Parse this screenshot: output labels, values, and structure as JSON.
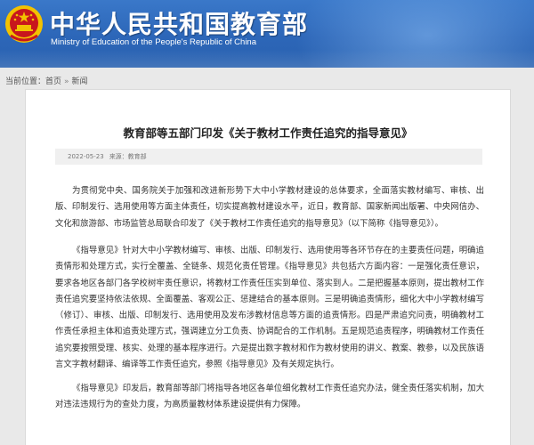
{
  "header": {
    "title_cn": "中华人民共和国教育部",
    "title_en": "Ministry of Education of the People's Republic of China",
    "emblem_icon": "national-emblem-icon",
    "colors": {
      "banner": "#2c66b8",
      "emblem_red": "#c8161d",
      "emblem_gold": "#f2c200"
    }
  },
  "breadcrumb": {
    "label": "当前位置：",
    "home": "首页",
    "separator": "»",
    "current": "新闻"
  },
  "article": {
    "title": "教育部等五部门印发《关于教材工作责任追究的指导意见》",
    "date": "2022-05-23",
    "source": "来源：教育部",
    "paragraphs": [
      "为贯彻党中央、国务院关于加强和改进新形势下大中小学教材建设的总体要求，全面落实教材编写、审核、出版、印制发行、选用使用等方面主体责任，切实提高教材建设水平，近日，教育部、国家新闻出版署、中央网信办、文化和旅游部、市场监管总局联合印发了《关于教材工作责任追究的指导意见》（以下简称《指导意见》）。",
      "《指导意见》针对大中小学教材编写、审核、出版、印制发行、选用使用等各环节存在的主要责任问题，明确追责情形和处理方式，实行全覆盖、全链条、规范化责任管理。《指导意见》共包括六方面内容：一是强化责任意识，要求各地区各部门各学校树牢责任意识，将教材工作责任压实到单位、落实到人。二是把握基本原则，提出教材工作责任追究要坚持依法依规、全面覆盖、客观公正、惩建结合的基本原则。三是明确追责情形，细化大中小学教材编写（修订）、审核、出版、印制发行、选用使用及发布涉教材信息等方面的追责情形。四是严肃追究问责，明确教材工作责任承担主体和追责处理方式，强调建立分工负责、协调配合的工作机制。五是规范追责程序，明确教材工作责任追究要按照受理、核实、处理的基本程序进行。六是提出数字教材和作为教材使用的讲义、教案、教参，以及民族语言文字教材翻译、编译等工作责任追究，参照《指导意见》及有关规定执行。",
      "《指导意见》印发后，教育部等部门将指导各地区各单位细化教材工作责任追究办法，健全责任落实机制，加大对违法违规行为的查处力度，为高质量教材体系建设提供有力保障。"
    ]
  }
}
